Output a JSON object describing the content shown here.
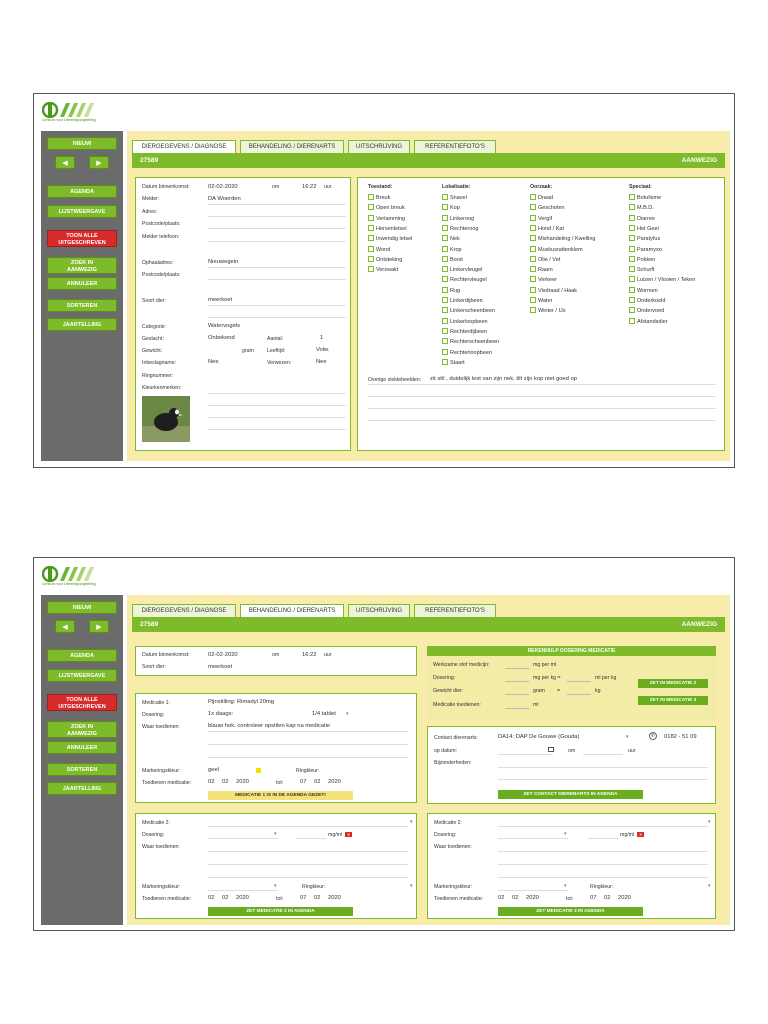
{
  "logo": {
    "tagline": "Centrum voor Dierenbijzorgstelling"
  },
  "sidebar": {
    "nieuw": "NIEUW",
    "prev": "◀",
    "next": "▶",
    "agenda": "AGENDA",
    "lijstweergave": "LIJSTWEERGAVE",
    "toon_alle_1": "TOON ALLE",
    "toon_alle_2": "UITGESCHREVEN",
    "zoek_1": "ZOEK IN",
    "zoek_2": "AANWEZIG",
    "annuleer": "ANNULEER",
    "sorteren": "SORTEREN",
    "jaartelling": "JAARTELLING"
  },
  "tabs": [
    "DIERGEGEVENS / DIAGNOSE",
    "BEHANDELING / DIERENARTS",
    "UITSCHRIJVING",
    "REFERENTIEFOTO'S"
  ],
  "record": {
    "id": "27589",
    "status": "AANWEZIG"
  },
  "screen1": {
    "labels": {
      "datum": "Datum binnenkomst:",
      "om": "om",
      "uur": "uur",
      "melder": "Melder:",
      "adres": "Adres:",
      "postcode": "Postcode/plaats:",
      "telefoon": "Melder telefoon:",
      "ophaaladres": "Ophaaladres:",
      "postcode2": "Postcode/plaats:",
      "soort": "Soort dier:",
      "categorie": "Categorie:",
      "geslacht": "Geslacht:",
      "aantal": "Aantal:",
      "gewicht": "Gewicht:",
      "gram": "gram",
      "leeftijd": "Leeftijd:",
      "inbeslagname": "Inbeslagname:",
      "verwezen": "Verwezen:",
      "ringnummer": "Ringnummer:",
      "kleurkenmerken": "Kleurkenmerken:"
    },
    "values": {
      "datum": "02-02-2020",
      "tijd": "16:22",
      "melder": "DA Woerden",
      "ophaaladres": "Nieuwegein",
      "soort": "meerkoet",
      "categorie": "Watervogels",
      "geslacht": "Onbekend",
      "aantal": "1",
      "leeftijd": "Volw.",
      "inbeslagname": "Nee",
      "verwezen": "Nee"
    },
    "headers": {
      "toestand": "Toestand:",
      "lokalisatie": "Lokalisatie:",
      "oorzaak": "Oorzaak:",
      "speciaal": "Speciaal:"
    },
    "toestand": [
      "Breuk",
      "Open breuk",
      "Verlamming",
      "Hersenletsel",
      "Inwendig letsel",
      "Wond",
      "Ontsteking",
      "Verzwakt"
    ],
    "lokalisatie": [
      "Snavel",
      "Kop",
      "Linkeroog",
      "Rechteroog",
      "Nek",
      "Krop",
      "Borst",
      "Linkervleugel",
      "Rechtervleugel",
      "Rug",
      "Linkerdijbeen",
      "Linkerscheenbeen",
      "Linkerloopbeen",
      "Rechterdijbeen",
      "Rechterscheenbeen",
      "Rechterloopbeen",
      "Staart"
    ],
    "oorzaak": [
      "Draad",
      "Geschoten",
      "Vergif",
      "Hond / Kat",
      "Mishandeling / Kwelling",
      "Muskusrattenklem",
      "Olie / Vet",
      "Raam",
      "Verkeer",
      "Visdraad / Haak",
      "Water",
      "Winter / IJs"
    ],
    "speciaal": [
      "Botulisme",
      "M.B.D.",
      "Diarree",
      "Het Geel",
      "Paratyfus",
      "Paramyxo",
      "Pokken",
      "Schurft",
      "Luizen / Vlooien / Teken",
      "Wormen",
      "Onderkoeld",
      "Ondervoed",
      "Afstandsdier"
    ],
    "overige_label": "Overige ziektebeelden:",
    "overige_value": "zit stil , duidelijk lest van zijn nek. tilt zijn kop niet goed op"
  },
  "screen2": {
    "labels": {
      "datum": "Datum binnenkomst:",
      "om": "om",
      "uur": "uur",
      "soort": "Soort dier:",
      "medicatie1": "Medicatie 1:",
      "dosering": "Dosering:",
      "waar": "Waar toedienen:",
      "markering": "Markeringskleur:",
      "ringkleur": "Ringkleur:",
      "toedienen": "Toedienen medicatie:",
      "tot": "tot:",
      "medicatie2": "Medicatie 2:",
      "medicatie3": "Medicatie 2:",
      "calc_title": "REKENHULP DOSERING MEDICATIE",
      "werkzame": "Werkzame stof medicijn:",
      "mgperml": "mg per ml",
      "dosering_calc": "Dosering:",
      "mgperkg": "mg per kg =",
      "mlperkg": "ml per kg",
      "gewicht": "Gewicht dier:",
      "gram": "gram",
      "eq": "=",
      "kg": "kg",
      "med_toedienen": "Medicatie toedienen:",
      "ml": "ml",
      "contact": "Contact dierenarts:",
      "opdatum": "op datum:",
      "bijzonderheden": "Bijzonderheden:",
      "mgml": "mg/ml"
    },
    "values": {
      "datum": "02-02-2020",
      "tijd": "16:22",
      "soort": "meerkoet",
      "medicijn": "Pijnstilling: Rimadyl 20mg",
      "dosering": "1x daags:",
      "dosering_amount": "1/4 tablet",
      "waar": "blauw hok. controleer opstilen kap na medicatie",
      "markering": "geel",
      "from_d": "02",
      "from_m": "02",
      "from_y": "2020",
      "to_d": "07",
      "to_m": "02",
      "to_y": "2020",
      "contact": "DA14: DAP De Gouwe (Gouda)",
      "phone": "0182 - 51 09",
      "m2_from_d": "02",
      "m2_from_m": "02",
      "m2_from_y": "2020",
      "m2_to_d": "07",
      "m2_to_m": "02",
      "m2_to_y": "2020",
      "m3_from_d": "02",
      "m3_from_m": "02",
      "m3_from_y": "2020",
      "m3_to_d": "07",
      "m3_to_m": "02",
      "m3_to_y": "2020"
    },
    "buttons": {
      "med1_agenda": "MEDICATIE 1 IS IN DE AGENDA GEZET!",
      "zet_med2": "ZET IN MEDICATIE 2",
      "zet_med3": "ZET IN MEDICATIE 3",
      "contact_agenda": "ZET CONTACT DIERENARTS IN AGENDA",
      "med2_agenda": "ZET MEDICATIE 2 IN AGENDA",
      "med3_agenda": "ZET MEDICATIE 3 IN AGENDA"
    }
  },
  "colors": {
    "accent": "#7dbb2a",
    "panel_bg": "#f7ecaa",
    "sidebar": "#6b6b6b",
    "red": "#d72b2b"
  }
}
